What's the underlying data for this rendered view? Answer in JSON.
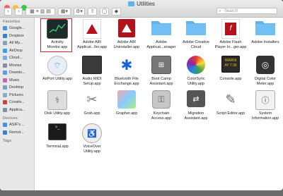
{
  "window": {
    "title": "Utilities"
  },
  "search": {
    "placeholder": "Search"
  },
  "sidebar": {
    "favorites_label": "Favorites",
    "favorites": [
      "Google...",
      "Dropbox",
      "All My...",
      "AirDrop",
      "Cloud...",
      "Movies",
      "Downlo...",
      "Music",
      "Desktop",
      "Pictures",
      "Creativ...",
      "Applica..."
    ],
    "devices_label": "Devices",
    "devices": [
      "ASIF's ...",
      "Remot..."
    ],
    "tags_label": "Tags"
  },
  "apps": [
    {
      "label1": "Activity",
      "label2": "Monitor.app"
    },
    {
      "label1": "Adobe AIR",
      "label2": "Applicat...ller.app"
    },
    {
      "label1": "Adobe AIR",
      "label2": "Uninstaller.app"
    },
    {
      "label1": "Adobe",
      "label2": "Applicat...anager"
    },
    {
      "label1": "Adobe Creative",
      "label2": "Cloud"
    },
    {
      "label1": "Adobe Flash",
      "label2": "Player In...ger.app"
    },
    {
      "label1": "Adobe Installers",
      "label2": ""
    },
    {
      "label1": "AirPort Utility.app",
      "label2": ""
    },
    {
      "label1": "Audio MIDI",
      "label2": "Setup.app"
    },
    {
      "label1": "Bluetooth File",
      "label2": "Exchange.app"
    },
    {
      "label1": "Boot Camp",
      "label2": "Assistant.app"
    },
    {
      "label1": "ColorSync",
      "label2": "Utility.app"
    },
    {
      "label1": "Console.app",
      "label2": ""
    },
    {
      "label1": "Digital Color",
      "label2": "Meter.app"
    },
    {
      "label1": "Disk Utility.app",
      "label2": ""
    },
    {
      "label1": "Grab.app",
      "label2": ""
    },
    {
      "label1": "Grapher.app",
      "label2": ""
    },
    {
      "label1": "Keychain",
      "label2": "Access.app"
    },
    {
      "label1": "Migration",
      "label2": "Assistant.app"
    },
    {
      "label1": "Script Editor.app",
      "label2": ""
    },
    {
      "label1": "System",
      "label2": "Information.app"
    },
    {
      "label1": "Terminal.app",
      "label2": ""
    },
    {
      "label1": "VoiceOver",
      "label2": "Utility.app"
    }
  ],
  "colors": {
    "folder": "#5fb3ee",
    "selection": "#e02020",
    "adobe_red": "#b3121b"
  }
}
